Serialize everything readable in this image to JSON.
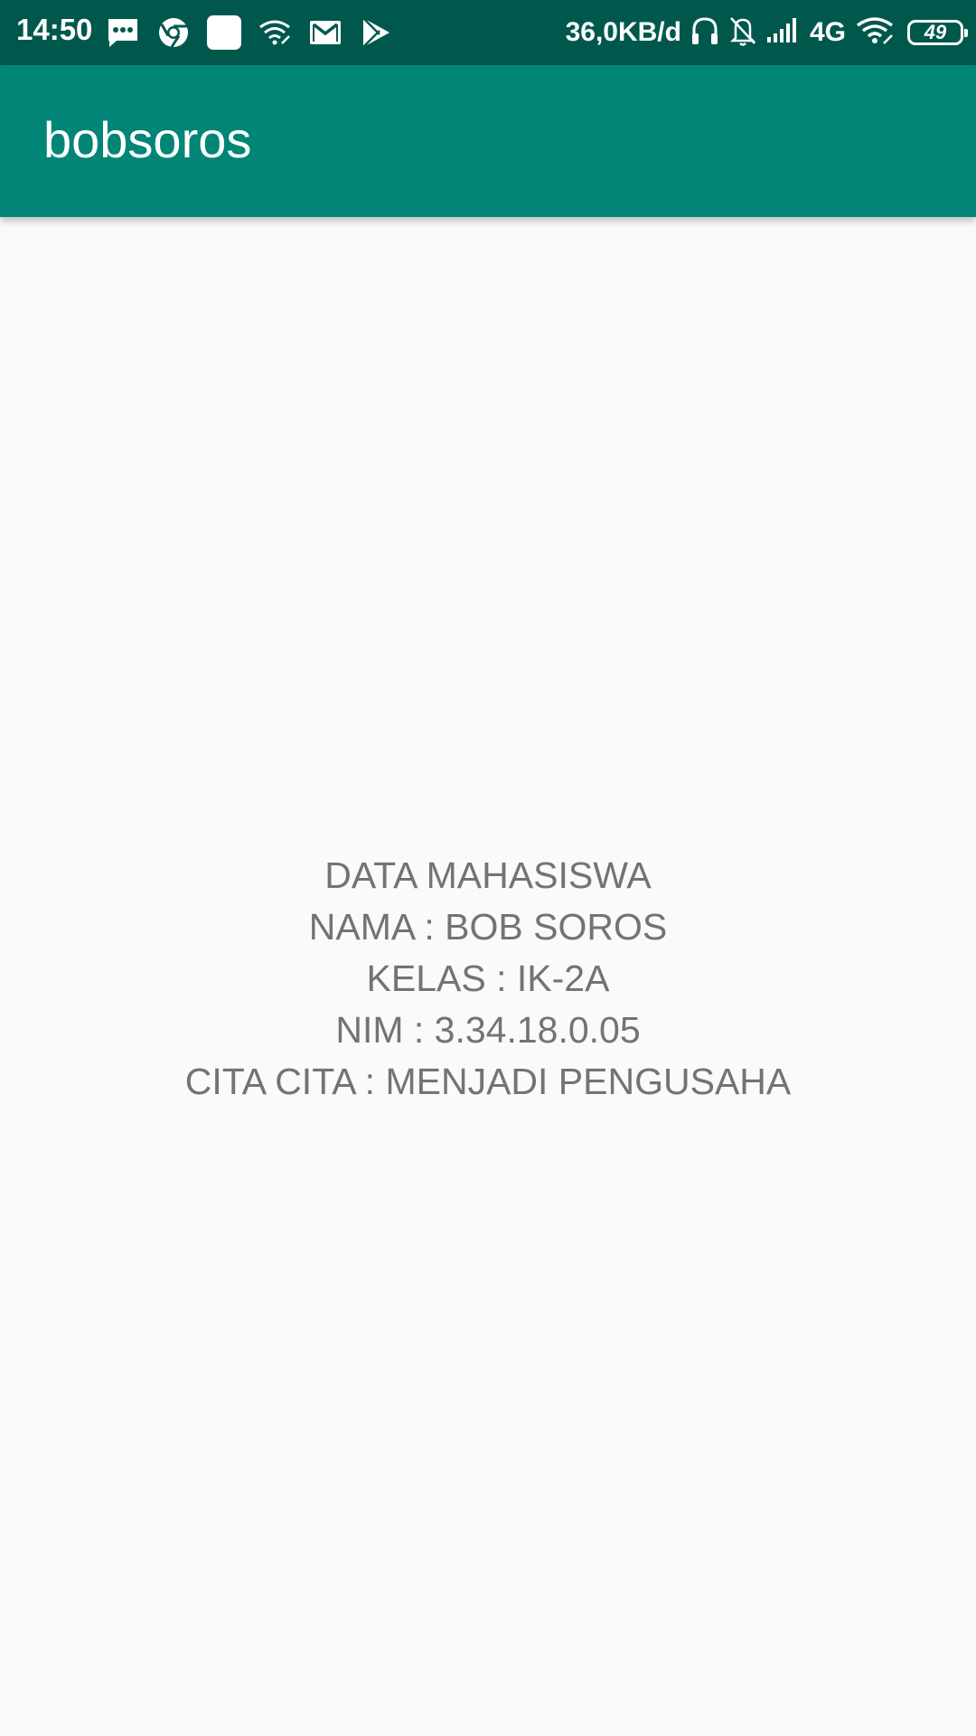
{
  "status_bar": {
    "time": "14:50",
    "net_speed": "36,0KB/d",
    "network_type": "4G",
    "battery_level": "49",
    "left_icons": [
      "message-icon",
      "chrome-icon",
      "app-square-icon",
      "wifi-hotspot-icon",
      "gmail-icon",
      "play-store-icon"
    ],
    "right_icons": [
      "headphones-icon",
      "notifications-off-icon",
      "cell-signal-icon",
      "wifi-icon",
      "battery-icon"
    ]
  },
  "app_bar": {
    "title": "bobsoros",
    "color": "#008577"
  },
  "content": {
    "lines": [
      "DATA MAHASISWA",
      "NAMA : BOB SOROS",
      "KELAS : IK-2A",
      "NIM : 3.34.18.0.05",
      "CITA CITA : MENJADI PENGUSAHA"
    ]
  },
  "colors": {
    "status_bar": "#00584d",
    "app_bar": "#008577",
    "background": "#fafafa",
    "text": "#737373"
  }
}
